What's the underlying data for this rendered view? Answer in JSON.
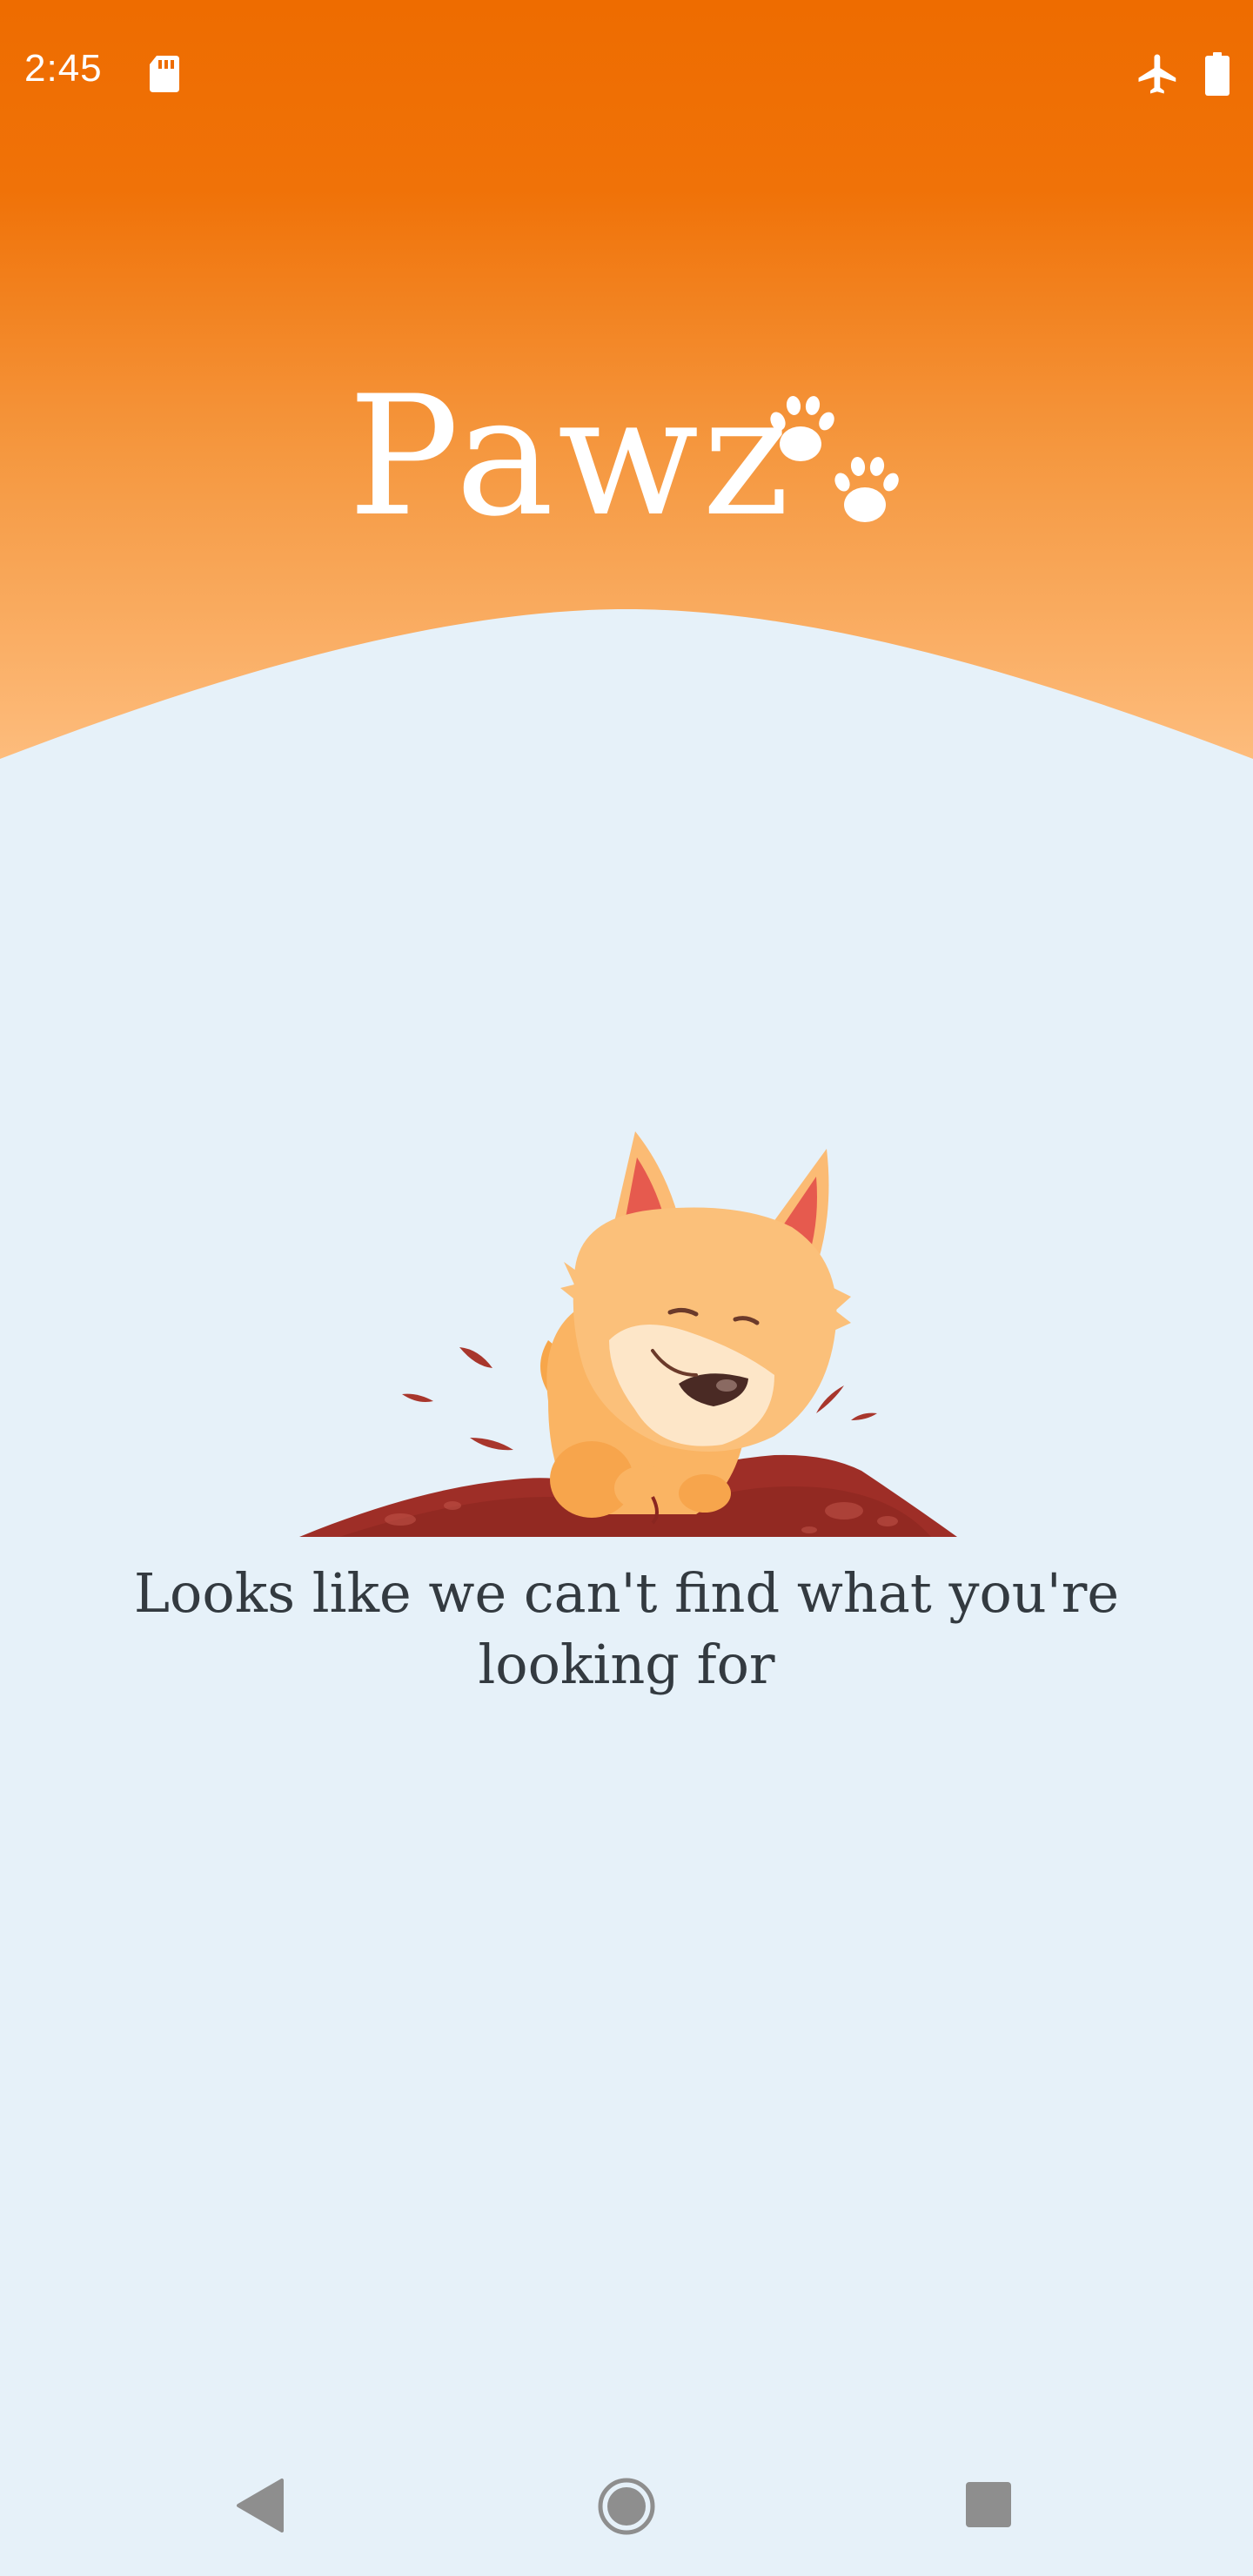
{
  "status_bar": {
    "time": "2:45",
    "icons": [
      "sd-card-icon",
      "airplane-mode-icon",
      "battery-icon"
    ]
  },
  "header": {
    "logo_text": "Pawz",
    "logo_icon": "paw-prints-icon"
  },
  "empty_state": {
    "illustration": "digging-dog-illustration",
    "message": "Looks like we can't find what you're looking for"
  },
  "nav_bar": {
    "icons": [
      "back-icon",
      "home-icon",
      "recents-icon"
    ]
  },
  "colors": {
    "header_top": "#ee6c00",
    "header_bottom": "#fdb877",
    "background": "#e6f1f9",
    "text": "#333a40"
  }
}
